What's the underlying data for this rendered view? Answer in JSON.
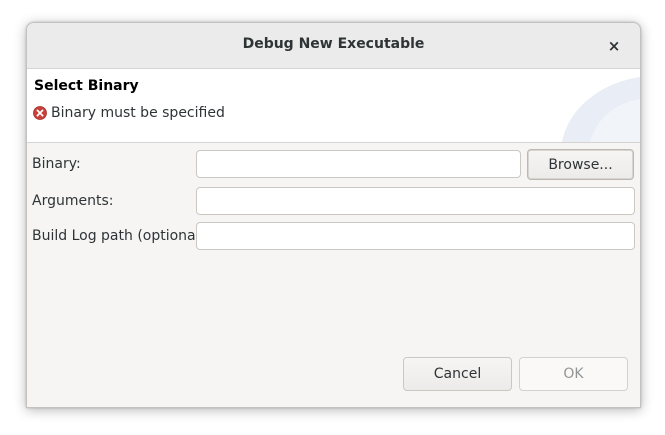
{
  "dialog": {
    "title": "Debug New Executable",
    "close_glyph": "×"
  },
  "banner": {
    "title": "Select Binary",
    "message": "Binary must be specified",
    "error_color": "#c7403a"
  },
  "form": {
    "binary_label": "Binary:",
    "binary_value": "",
    "browse_label": "Browse...",
    "arguments_label": "Arguments:",
    "arguments_value": "",
    "buildlog_label": "Build Log path (optional):",
    "buildlog_value": ""
  },
  "buttons": {
    "cancel_label": "Cancel",
    "ok_label": "OK",
    "ok_enabled": false
  }
}
